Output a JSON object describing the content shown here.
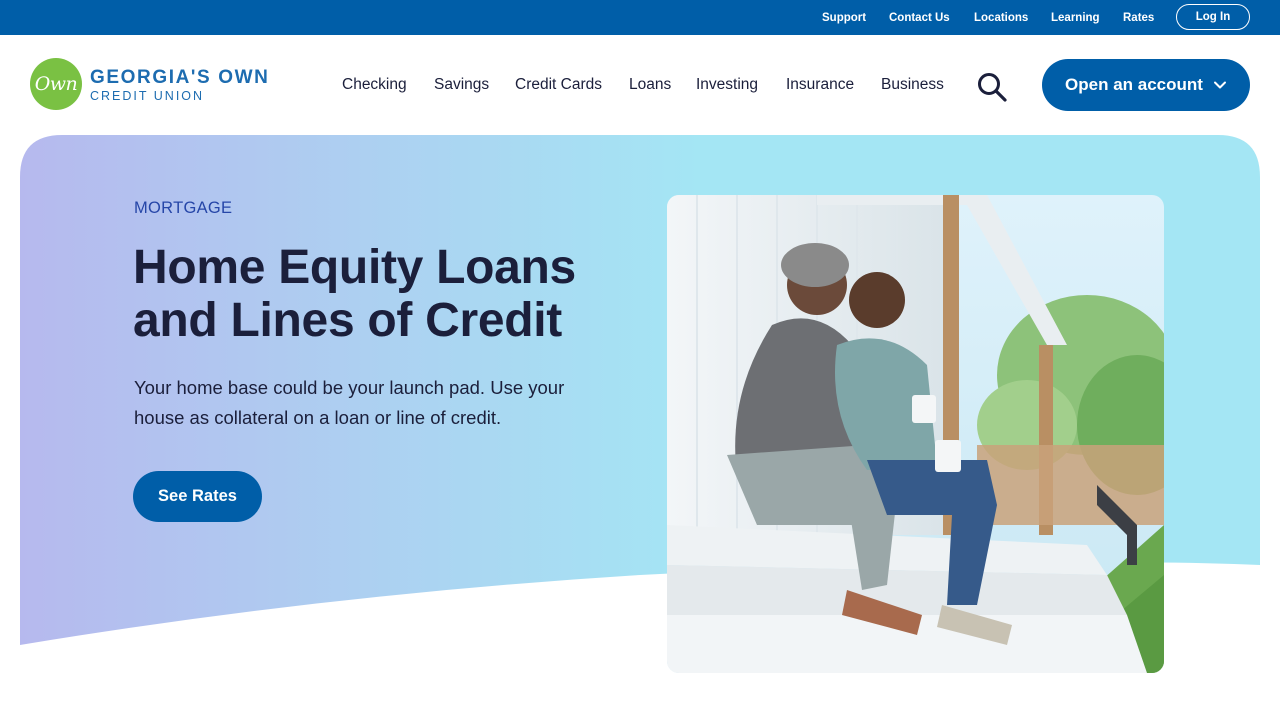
{
  "utility_nav": {
    "links": [
      "Support",
      "Contact Us",
      "Locations",
      "Learning",
      "Rates"
    ],
    "login_label": "Log In"
  },
  "logo": {
    "mark_text": "Own",
    "name": "GEORGIA'S OWN",
    "subtitle": "CREDIT UNION"
  },
  "main_nav": {
    "items": [
      "Checking",
      "Savings",
      "Credit Cards",
      "Loans",
      "Investing",
      "Insurance",
      "Business"
    ],
    "search_icon": "search-icon",
    "cta_label": "Open an account",
    "cta_icon": "chevron-down-icon"
  },
  "hero": {
    "eyebrow": "MORTGAGE",
    "headline": "Home Equity Loans and Lines of Credit",
    "body": "Your home base could be your launch pad. Use your house as collateral on a loan or line of credit.",
    "button_label": "See Rates",
    "photo_alt": "couple-on-porch-photo"
  },
  "colors": {
    "brand_blue": "#005ea8",
    "logo_green": "#7ac143",
    "eyebrow_blue": "#2646a8",
    "hero_gradient_start": "#b6b9ee",
    "hero_gradient_end": "#a4e6f4",
    "text_dark": "#1b1f3b"
  }
}
